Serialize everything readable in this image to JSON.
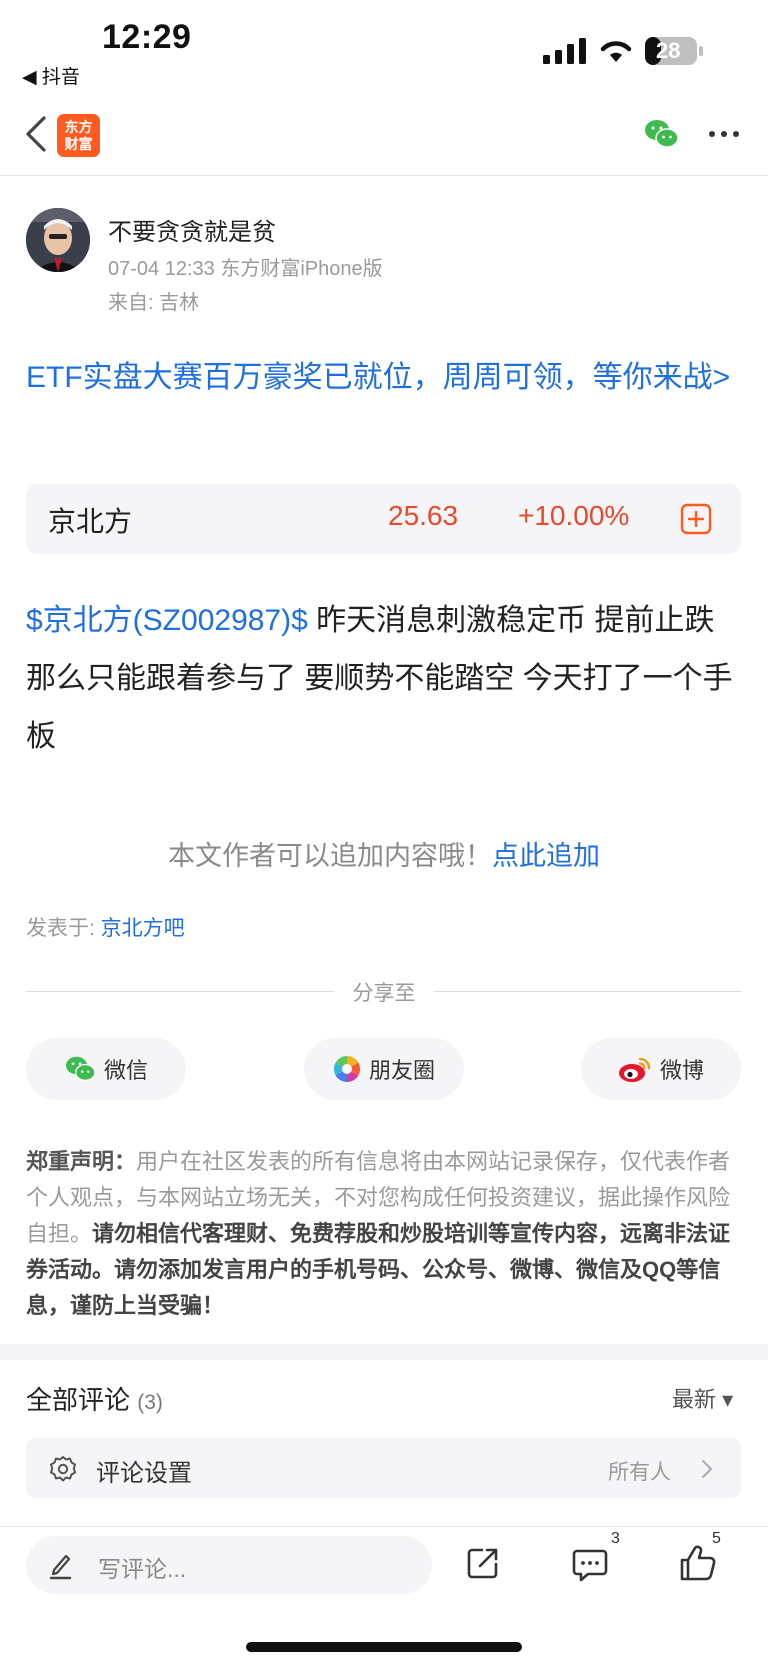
{
  "status_bar": {
    "time": "12:29",
    "back_app": "◀ 抖音",
    "battery": "28"
  },
  "nav": {
    "logo_line1": "东方",
    "logo_line2": "财富"
  },
  "author": {
    "name": "不要贪贪就是贫",
    "meta": "07-04 12:33 东方财富iPhone版",
    "location": "来自: 吉林"
  },
  "promo": {
    "text": "ETF实盘大赛百万豪奖已就位，周周可领，等你来战>"
  },
  "stock": {
    "name": "京北方",
    "price": "25.63",
    "change": "+10.00%"
  },
  "post": {
    "tag": "$京北方(SZ002987)$",
    "text": "  昨天消息刺激稳定币 提前止跌 那么只能跟着参与了 要顺势不能踏空 今天打了一个手板"
  },
  "append": {
    "prompt": "本文作者可以追加内容哦！",
    "link": "点此追加"
  },
  "posted_in": {
    "label": "发表于: ",
    "bar": "京北方吧"
  },
  "share": {
    "title": "分享至",
    "buttons": [
      {
        "label": "微信",
        "icon": "wechat-icon"
      },
      {
        "label": "朋友圈",
        "icon": "moments-icon"
      },
      {
        "label": "微博",
        "icon": "weibo-icon"
      }
    ]
  },
  "disclaimer": {
    "head": "郑重声明：",
    "normal": "用户在社区发表的所有信息将由本网站记录保存，仅代表作者个人观点，与本网站立场无关，不对您构成任何投资建议，据此操作风险自担。",
    "bold": "请勿相信代客理财、免费荐股和炒股培训等宣传内容，远离非法证券活动。请勿添加发言用户的手机号码、公众号、微博、微信及QQ等信息，谨防上当受骗！"
  },
  "comments": {
    "title": "全部评论",
    "count": "(3)",
    "sort": "最新 ▾",
    "settings_label": "评论设置",
    "settings_value": "所有人"
  },
  "bottom_bar": {
    "placeholder": "写评论...",
    "comment_count": "3",
    "like_count": "5"
  },
  "colors": {
    "link": "#1f6fe0",
    "up": "#e8492c",
    "brand": "#ff5a1f",
    "wechat": "#3dbb4f"
  }
}
